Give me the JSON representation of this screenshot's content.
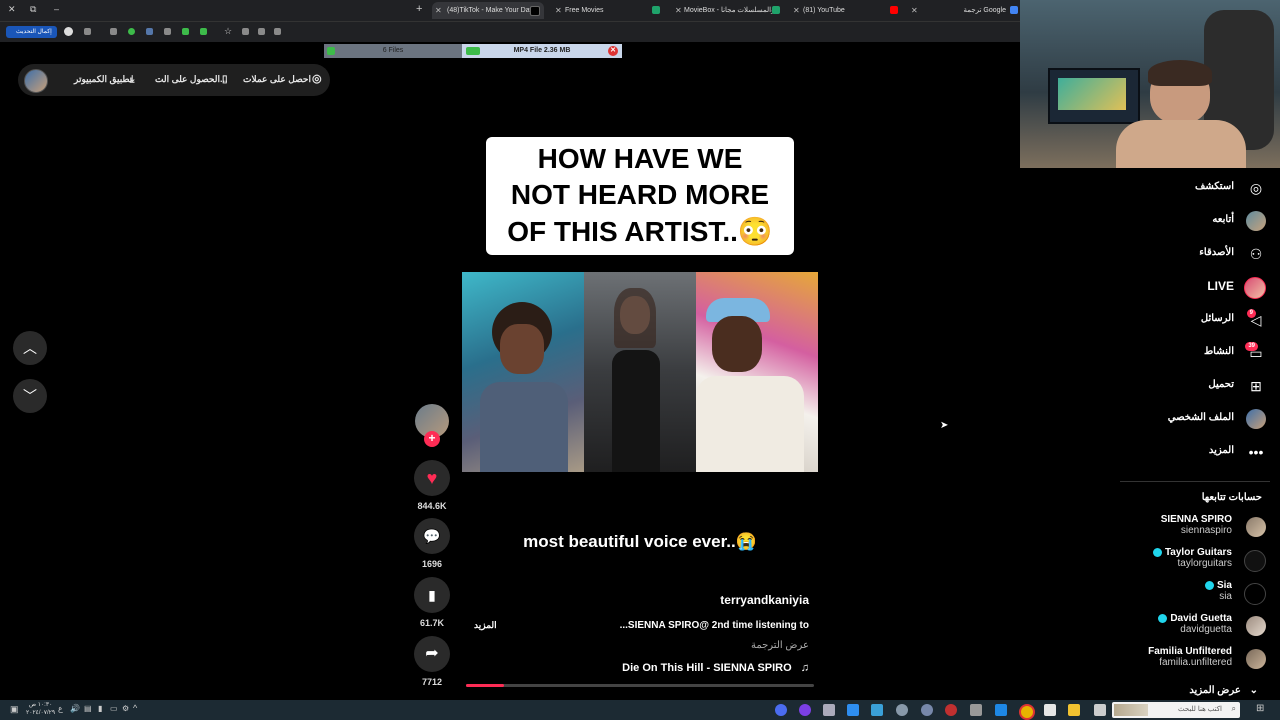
{
  "browser": {
    "tabs": [
      {
        "label": "(48)TikTok - Make Your Day",
        "active": true
      },
      {
        "label": "Free Movies",
        "active": false
      },
      {
        "label": "MovieBox - والمسلسلات مجانا",
        "active": false
      },
      {
        "label": "(81) YouTube",
        "active": false
      },
      {
        "label": "ترجمة Google",
        "active": false
      }
    ],
    "new_tab": "+",
    "update_button": "إكمال التحديث",
    "downloads": {
      "files": "6 Files",
      "current": "MP4 File 2.36 MB"
    }
  },
  "promo": {
    "coins": "احصل على عملات",
    "get_app": "الحصول على الت...",
    "desktop_app": "تطبيق الكمبيوتر"
  },
  "video": {
    "overlay_lines": [
      "HOW HAVE WE",
      "NOT HEARD MORE",
      "OF THIS ARTIST..😳"
    ],
    "caption": "most beautiful voice ever..😭",
    "author": "terryandkaniyia",
    "description": "...SIENNA SPIRO@ 2nd time listening to",
    "more": "المزيد",
    "see_translation": "عرض الترجمة",
    "sound": "Die On This Hill - SIENNA SPIRO",
    "progress": 0.11
  },
  "actions": {
    "likes": "844.6K",
    "comments": "1696",
    "saves": "61.7K",
    "shares": "7712"
  },
  "sidebar": {
    "items": [
      {
        "label": "استكشف",
        "icon": "compass-icon"
      },
      {
        "label": "أتابعه",
        "icon": "following-avatar-icon"
      },
      {
        "label": "الأصدقاء",
        "icon": "friends-icon"
      },
      {
        "label": "LIVE",
        "icon": "live-avatar-icon"
      },
      {
        "label": "الرسائل",
        "icon": "send-icon",
        "badge": "9"
      },
      {
        "label": "النشاط",
        "icon": "inbox-icon",
        "badge": "39"
      },
      {
        "label": "تحميل",
        "icon": "upload-icon"
      },
      {
        "label": "الملف الشخصي",
        "icon": "profile-avatar-icon"
      },
      {
        "label": "المزيد",
        "icon": "more-icon"
      }
    ],
    "following_title": "حسابات تتابعها",
    "accounts": [
      {
        "name": "SIENNA SPIRO",
        "handle": "siennaspiro",
        "verified": false
      },
      {
        "name": "Taylor Guitars",
        "handle": "taylorguitars",
        "verified": true
      },
      {
        "name": "Sia",
        "handle": "sia",
        "verified": true
      },
      {
        "name": "David Guetta",
        "handle": "davidguetta",
        "verified": true
      },
      {
        "name": "Familia Unfiltered",
        "handle": "familia.unfiltered",
        "verified": false
      }
    ],
    "see_more": "عرض المزيد"
  },
  "taskbar": {
    "search_placeholder": "اكتب هنا للبحث",
    "time": "١٠:٣٠ ص",
    "date": "٢٠٢٤/٠٧/٢٩"
  },
  "colors": {
    "accent": "#fe2c55",
    "verified": "#20d5ec",
    "sidebar_bg": "#000000"
  }
}
